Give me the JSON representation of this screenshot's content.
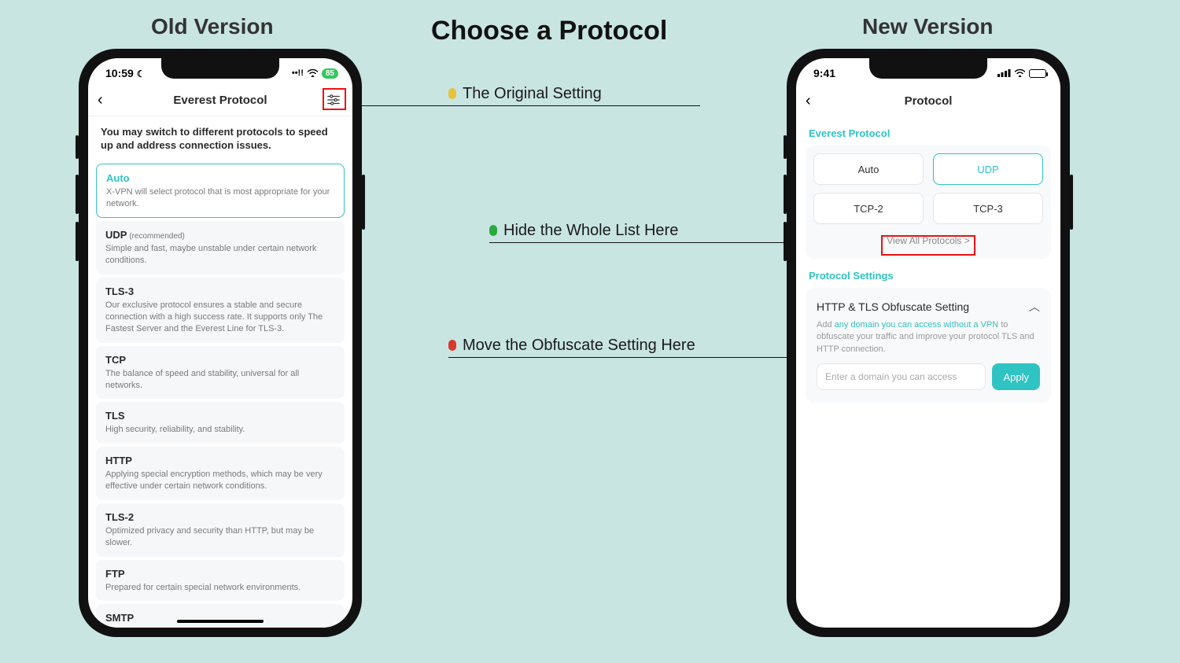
{
  "headings": {
    "old": "Old Version",
    "new": "New Version",
    "main": "Choose a Protocol"
  },
  "annotations": {
    "a1": "The Original Setting",
    "a2": "Hide the Whole List Here",
    "a3": "Move the Obfuscate Setting Here"
  },
  "old": {
    "time": "10:59",
    "battery": "85",
    "header_title": "Everest Protocol",
    "intro": "You may switch to different protocols to speed up and address connection issues.",
    "protocols": [
      {
        "name": "Auto",
        "desc": "X-VPN will select protocol that is most appropriate for your network.",
        "selected": true
      },
      {
        "name": "UDP",
        "rec": "(recommended)",
        "desc": "Simple and fast, maybe unstable under certain network conditions."
      },
      {
        "name": "TLS-3",
        "desc": "Our exclusive protocol ensures a stable and secure connection with a high success rate. It supports only The Fastest Server and the Everest Line for TLS-3."
      },
      {
        "name": "TCP",
        "desc": "The balance of speed and stability, universal for all networks."
      },
      {
        "name": "TLS",
        "desc": "High security, reliability, and stability."
      },
      {
        "name": "HTTP",
        "desc": "Applying special encryption methods, which may be very effective under certain network conditions."
      },
      {
        "name": "TLS-2",
        "desc": "Optimized privacy and security than HTTP, but may be slower."
      },
      {
        "name": "FTP",
        "desc": "Prepared for certain special network environments."
      },
      {
        "name": "SMTP",
        "desc": ""
      }
    ]
  },
  "new": {
    "time": "9:41",
    "header_title": "Protocol",
    "section_protocol": "Everest Protocol",
    "grid": [
      "Auto",
      "UDP",
      "TCP-2",
      "TCP-3"
    ],
    "grid_active_index": 1,
    "view_all": "View All Protocols >",
    "section_settings": "Protocol Settings",
    "obf_title": "HTTP & TLS Obfuscate Setting",
    "obf_desc_pre": "Add ",
    "obf_link": "any domain you can access without a VPN",
    "obf_desc_post": " to obfuscate your traffic and improve your protocol TLS and HTTP connection.",
    "obf_placeholder": "Enter a domain you can access",
    "apply": "Apply"
  }
}
